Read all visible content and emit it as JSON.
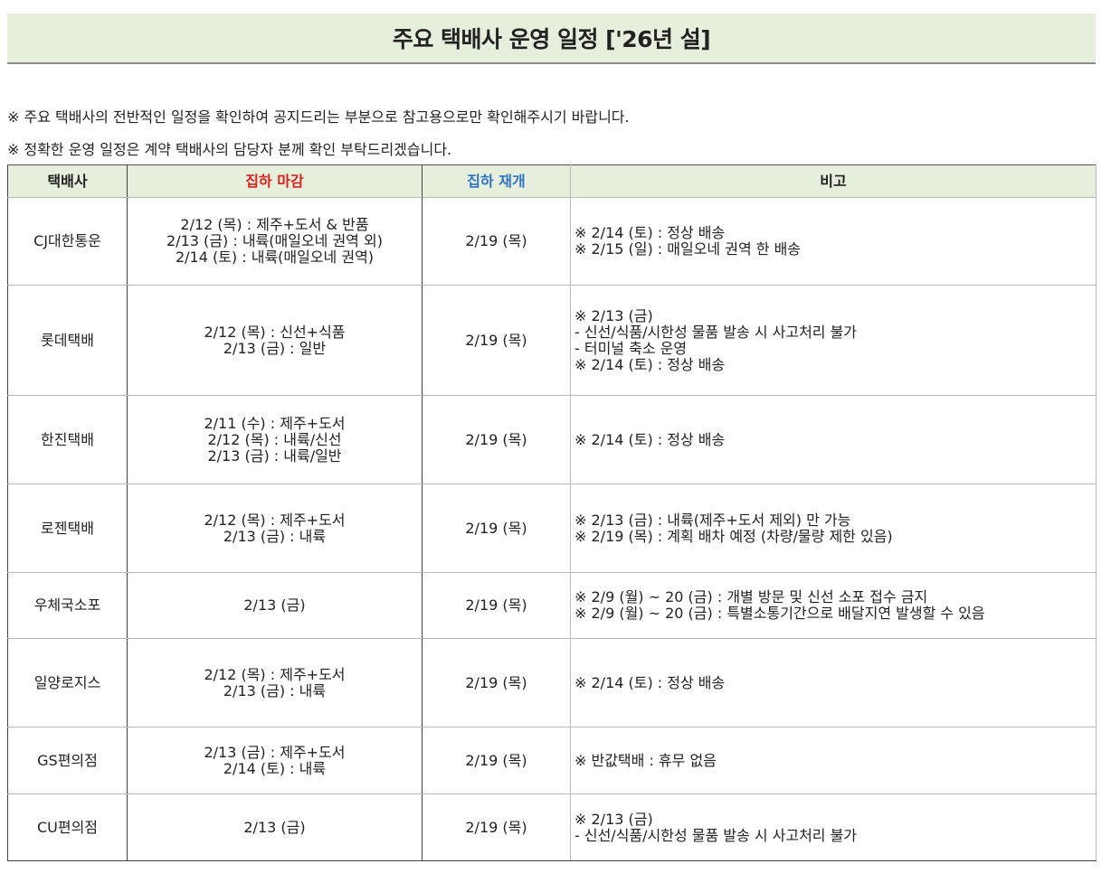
{
  "title": "주요 택배사 운영 일정 ['26년 설]",
  "notices": [
    "※ 주요 택배사의 전반적인 일정을 확인하여 공지드리는 부분으로 참고용으로만 확인해주시기 바랍니다.",
    "※ 정확한 운영 일정은 계약 택배사의 담당자 분께 확인 부탁드리겠습니다."
  ],
  "colors": {
    "header_bg": "#e6efdc",
    "closing_header": "#e0201c",
    "reopen_header": "#2e73c6"
  },
  "table": {
    "headers": {
      "carrier": "택배사",
      "closing": "집하 마감",
      "reopen": "집하 재개",
      "notes": "비고"
    },
    "rows": [
      {
        "carrier": "CJ대한통운",
        "closing": [
          "2/12 (목) : 제주+도서 & 반품",
          "2/13 (금) : 내륙(매일오네 권역 외)",
          "2/14 (토) : 내륙(매일오네 권역)"
        ],
        "reopen": "2/19 (목)",
        "notes": [
          "※ 2/14 (토) : 정상 배송",
          "※ 2/15 (일) : 매일오네 권역 한 배송"
        ]
      },
      {
        "carrier": "롯데택배",
        "closing": [
          "2/12 (목) : 신선+식품",
          "2/13 (금) : 일반"
        ],
        "reopen": "2/19 (목)",
        "notes": [
          "※ 2/13 (금)",
          "- 신선/식품/시한성 물품 발송 시 사고처리 불가",
          "- 터미널 축소 운영",
          "※ 2/14 (토) : 정상 배송"
        ]
      },
      {
        "carrier": "한진택배",
        "closing": [
          "2/11 (수) : 제주+도서",
          "2/12 (목) : 내륙/신선",
          "2/13 (금) : 내륙/일반"
        ],
        "reopen": "2/19 (목)",
        "notes": [
          "※ 2/14 (토) : 정상 배송"
        ]
      },
      {
        "carrier": "로젠택배",
        "closing": [
          "2/12 (목) : 제주+도서",
          "2/13 (금) : 내륙"
        ],
        "reopen": "2/19 (목)",
        "notes": [
          "※ 2/13 (금) : 내륙(제주+도서 제외) 만 가능",
          "※ 2/19 (목) : 계획 배차 예정 (차량/물량 제한 있음)"
        ]
      },
      {
        "carrier": "우체국소포",
        "closing": [
          "2/13 (금)"
        ],
        "reopen": "2/19 (목)",
        "notes": [
          "※ 2/9 (월) ~ 20 (금) : 개별 방문 및 신선 소포 접수 금지",
          "※ 2/9 (월) ~ 20 (금) : 특별소통기간으로 배달지연 발생할 수 있음"
        ]
      },
      {
        "carrier": "일양로지스",
        "closing": [
          "2/12 (목) : 제주+도서",
          "2/13 (금) : 내륙"
        ],
        "reopen": "2/19 (목)",
        "notes": [
          "※ 2/14 (토) : 정상 배송"
        ]
      },
      {
        "carrier": "GS편의점",
        "closing": [
          "2/13 (금) : 제주+도서",
          "2/14 (토) : 내륙"
        ],
        "reopen": "2/19 (목)",
        "notes": [
          "※ 반값택배 : 휴무 없음"
        ]
      },
      {
        "carrier": "CU편의점",
        "closing": [
          "2/13 (금)"
        ],
        "reopen": "2/19 (목)",
        "notes": [
          "※ 2/13 (금)",
          "- 신선/식품/시한성 물품 발송 시 사고처리 불가"
        ]
      }
    ]
  }
}
